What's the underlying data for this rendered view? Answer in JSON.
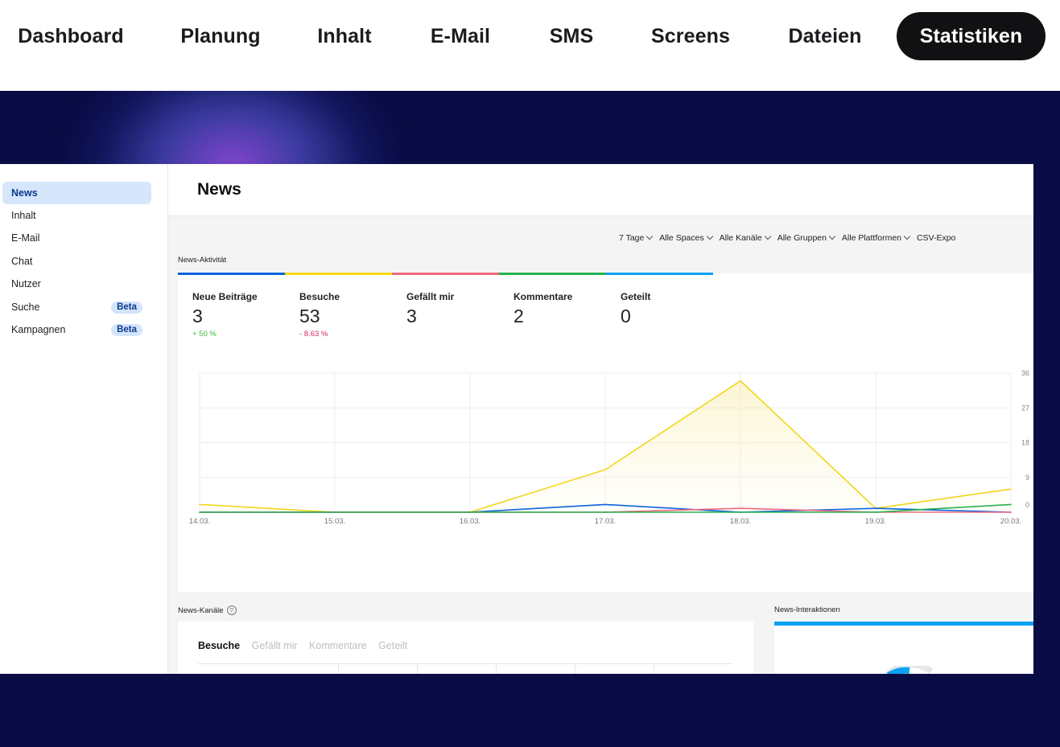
{
  "topnav": {
    "tabs": [
      "Dashboard",
      "Planung",
      "Inhalt",
      "E-Mail",
      "SMS",
      "Screens",
      "Dateien",
      "Statistiken"
    ],
    "active": "Statistiken"
  },
  "sidebar": {
    "items": [
      {
        "label": "News",
        "active": true
      },
      {
        "label": "Inhalt"
      },
      {
        "label": "E-Mail"
      },
      {
        "label": "Chat"
      },
      {
        "label": "Nutzer"
      },
      {
        "label": "Suche",
        "badge": "Beta"
      },
      {
        "label": "Kampagnen",
        "badge": "Beta"
      }
    ]
  },
  "page": {
    "title": "News",
    "filters": [
      "7 Tage",
      "Alle Spaces",
      "Alle Kanäle",
      "Alle Gruppen",
      "Alle Plattformen",
      "CSV-Expo"
    ],
    "activity_label": "News-Aktivität",
    "channels_label": "News-Kanäle",
    "interactions_label": "News-Interaktionen",
    "channel_tabs": [
      "Besuche",
      "Gefällt mir",
      "Kommentare",
      "Geteilt"
    ]
  },
  "metrics": [
    {
      "label": "Neue Beiträge",
      "value": "3",
      "change": "+ 50 %",
      "change_color": "#3dbb3a",
      "bar_color": "#0d63e0"
    },
    {
      "label": "Besuche",
      "value": "53",
      "change": "- 8.63 %",
      "change_color": "#d2295b",
      "bar_color": "#f7d90c"
    },
    {
      "label": "Gefällt mir",
      "value": "3",
      "change": "",
      "bar_color": "#f06a7f"
    },
    {
      "label": "Kommentare",
      "value": "2",
      "change": "",
      "bar_color": "#27b24e"
    },
    {
      "label": "Geteilt",
      "value": "0",
      "change": "",
      "bar_color": "#0aa2f2"
    }
  ],
  "chart_data": {
    "type": "line",
    "x": [
      "14.03.",
      "15.03.",
      "16.03.",
      "17.03.",
      "18.03.",
      "19.03.",
      "20.03."
    ],
    "y_ticks": [
      "0",
      "9",
      "18",
      "27",
      "36"
    ],
    "ylim": [
      0,
      36
    ],
    "grid": true,
    "series": [
      {
        "values": [
          2,
          0,
          0,
          11,
          34,
          1,
          6
        ],
        "color": "#f2d61a",
        "fill": true
      },
      {
        "values": [
          0,
          0,
          0,
          2,
          0,
          1,
          0
        ],
        "color": "#0d63e0"
      },
      {
        "values": [
          0,
          0,
          0,
          0,
          1,
          0,
          0
        ],
        "color": "#f06a7f"
      },
      {
        "values": [
          0,
          0,
          0,
          0,
          0,
          0,
          2
        ],
        "color": "#27b24e"
      }
    ]
  }
}
